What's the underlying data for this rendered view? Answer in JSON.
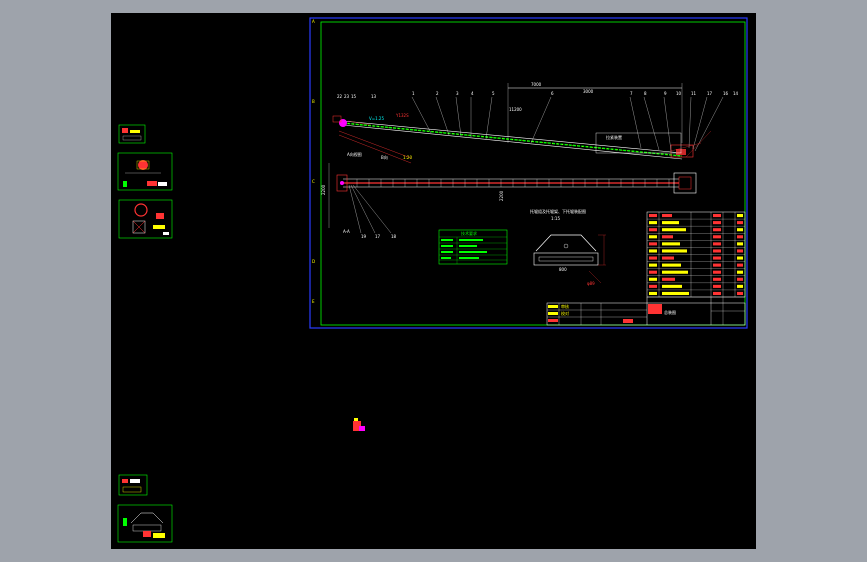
{
  "app": {
    "type": "CAD model space viewer"
  },
  "colors": {
    "background": "#9ea3ab",
    "canvas": "#000000",
    "frame_outer": "#2a3cff",
    "frame_inner": "#00ff00",
    "line_main": "#ffffff",
    "belt": "#00ff00",
    "dimension": "#ff3333",
    "highlight": "#ff00ff",
    "note_text": "#ffff00",
    "cyan": "#00ffff"
  },
  "main_sheet": {
    "title_block_left": [
      "审核",
      "校对"
    ],
    "title_block_right": "总装图",
    "dims": {
      "top_overall": "7000",
      "right_segment": "3000",
      "mid": "11200",
      "vertical_left": "2200",
      "vertical_mid": "2200"
    },
    "labels": {
      "view_a": "A向视图",
      "view_b": "A-A",
      "section_title": "托辊组及托辊架、下托辊装配图",
      "section_scale": "1:15",
      "note_table_title": "技术要求"
    },
    "numbers_top": [
      "22",
      "23",
      "15",
      "13",
      "1",
      "2",
      "3",
      "4",
      "5",
      "6",
      "7",
      "8",
      "9",
      "10",
      "11",
      "17",
      "16",
      "14"
    ],
    "numbers_bottom": [
      "19",
      "17",
      "18"
    ]
  },
  "parts_list": {
    "rows": 12
  }
}
